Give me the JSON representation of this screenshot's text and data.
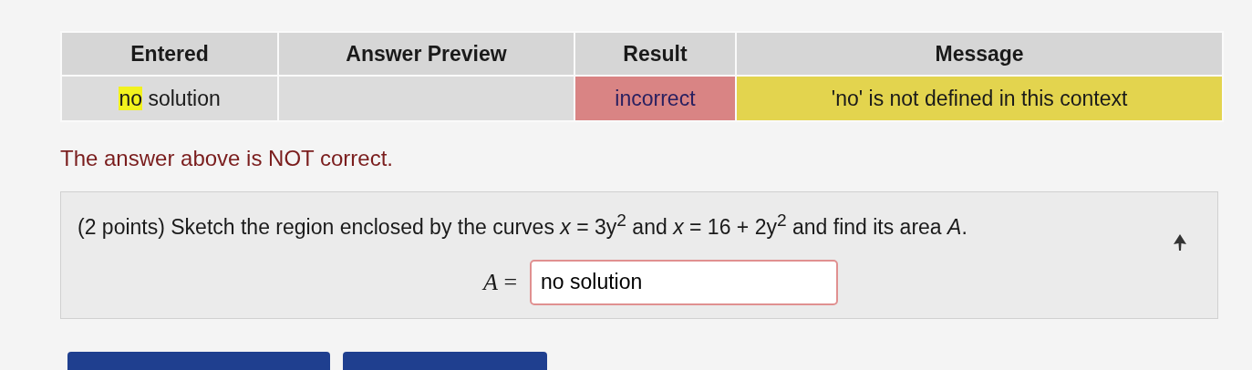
{
  "results_table": {
    "columns": [
      "Entered",
      "Answer Preview",
      "Result",
      "Message"
    ],
    "rows": [
      {
        "entered": [
          {
            "text": "no",
            "highlighted": true
          },
          {
            "text": " solution",
            "highlighted": false
          }
        ],
        "result": "incorrect",
        "correct": false,
        "message": "'no' is not defined in this context"
      }
    ]
  },
  "feedback": "The answer above is NOT correct.",
  "problem": {
    "text": "(2 points) Sketch the region enclosed by the curves *x* = 3y$^{2}$ and *x* = 16 + 2y$^{2}$ and find its area *A*.",
    "answer_label": "*A* =",
    "answer_value": "no solution",
    "answer_correct": false
  }
}
